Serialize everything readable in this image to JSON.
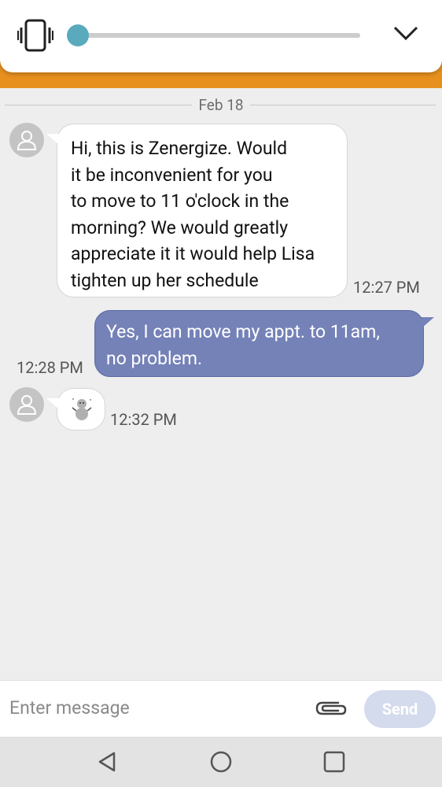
{
  "volume_panel": {
    "mode_icon": "vibrate-icon",
    "volume_level": 0,
    "collapse_icon": "chevron-down-icon"
  },
  "conversation": {
    "date_divider": "Feb 18",
    "messages": [
      {
        "direction": "incoming",
        "text": "Hi, this is Zenergize. Would it be inconvenient for you to move to 11 o'clock in the morning? We would greatly appreciate it it would help Lisa tighten up her schedule",
        "lines": [
          "Hi, this is Zenergize. Would",
          "it be inconvenient for you",
          "to move to 11 o'clock in the",
          "morning? We would greatly",
          "appreciate it it would help Lisa",
          "tighten up her schedule"
        ],
        "time": "12:27 PM"
      },
      {
        "direction": "outgoing",
        "text": "Yes, I can move my appt. to 11am, no problem.",
        "lines": [
          "Yes, I can move my appt. to 11am,",
          "no problem."
        ],
        "time": "12:28 PM"
      },
      {
        "direction": "incoming",
        "type": "sticker",
        "sticker_icon": "snowman-sticker-icon",
        "time": "12:32 PM"
      }
    ]
  },
  "composer": {
    "placeholder": "Enter message",
    "attach_icon": "paperclip-icon",
    "send_label": "Send"
  },
  "navbar": {
    "back_icon": "back-triangle-icon",
    "home_icon": "home-circle-icon",
    "recents_icon": "recents-square-icon"
  },
  "colors": {
    "accent_orange": "#e8901e",
    "slider_thumb": "#5aaabd",
    "outgoing_bubble": "#7582b8",
    "send_button_disabled": "#d4dbed",
    "background": "#eeeeee"
  }
}
